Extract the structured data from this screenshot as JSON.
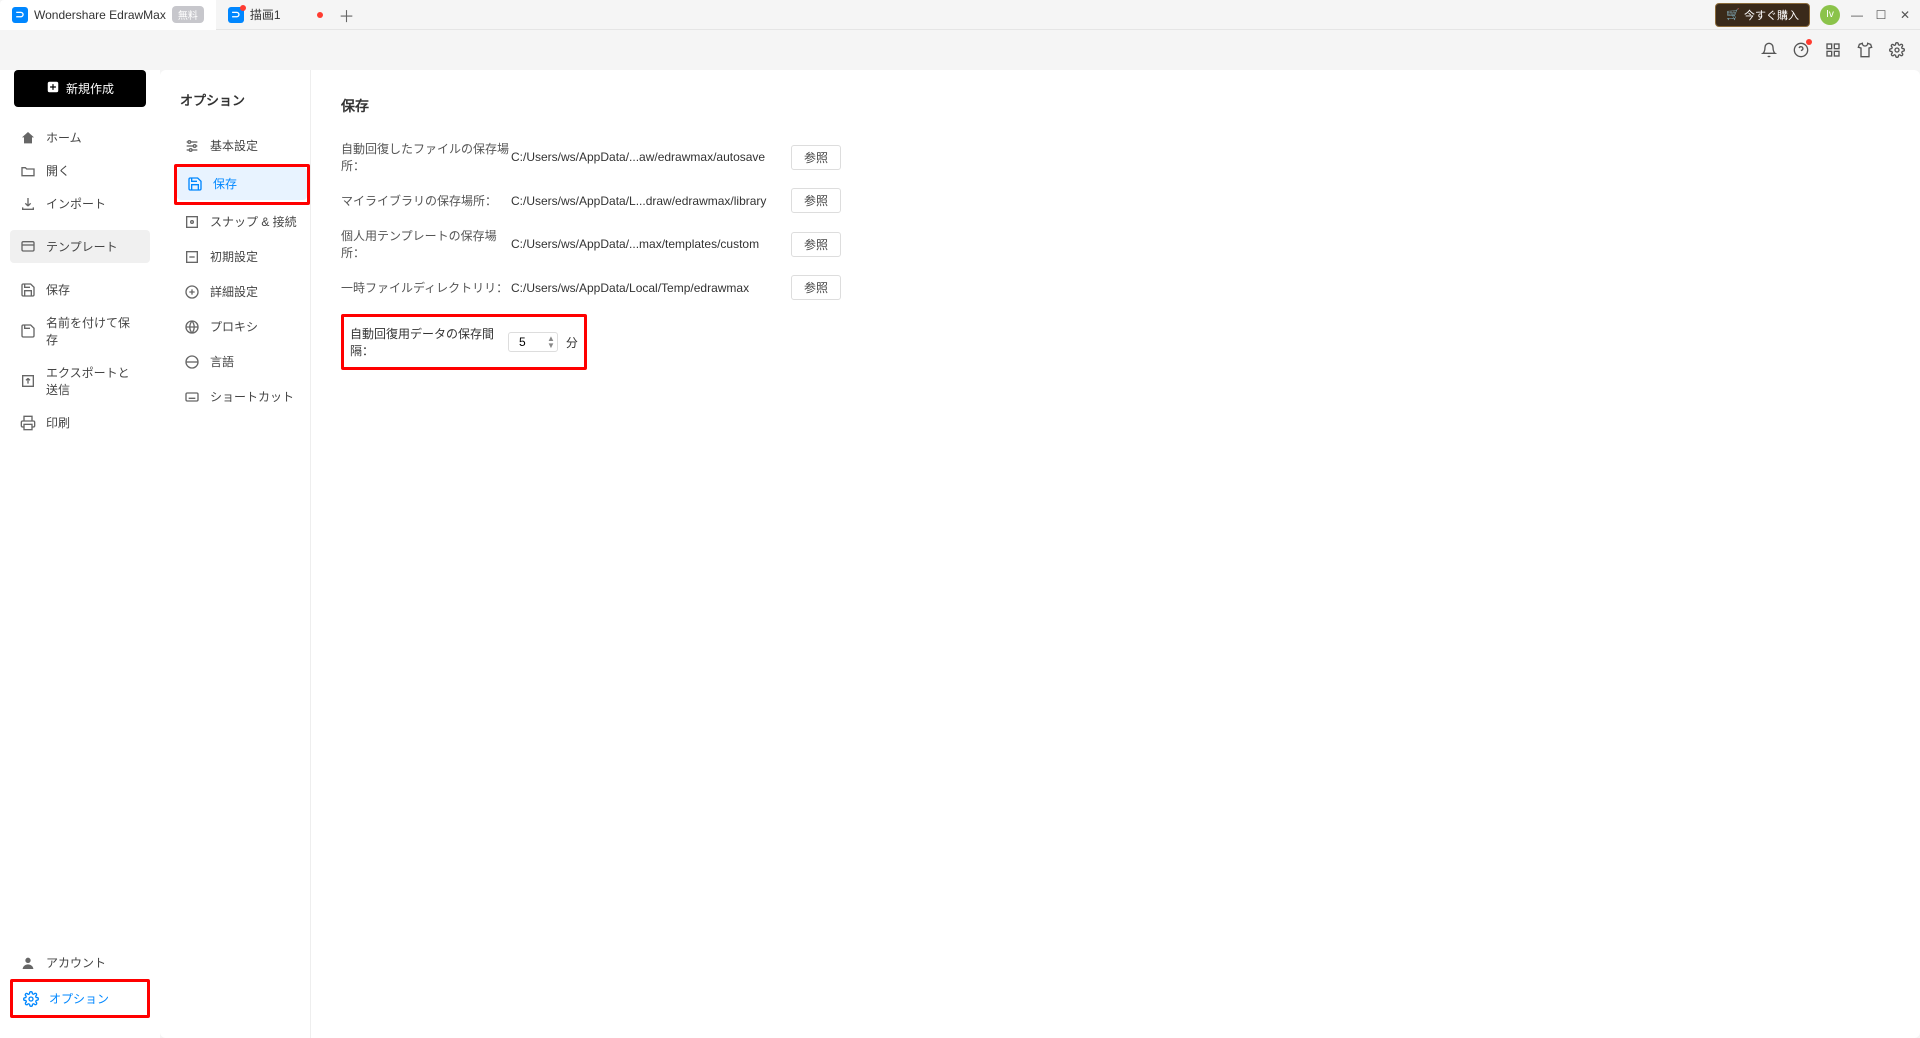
{
  "titlebar": {
    "app_name": "Wondershare EdrawMax",
    "badge_free": "無料",
    "doc_tab": "描画1",
    "buy_label": "今すぐ購入",
    "avatar_initial": "Iv"
  },
  "filemenu": {
    "new_btn": "新規作成",
    "home": "ホーム",
    "open": "開く",
    "import": "インポート",
    "template": "テンプレート",
    "save": "保存",
    "save_as": "名前を付けて保存",
    "export": "エクスポートと送信",
    "print": "印刷",
    "account": "アカウント",
    "options": "オプション"
  },
  "options_nav": {
    "title": "オプション",
    "basic": "基本設定",
    "save": "保存",
    "snap": "スナップ & 接続",
    "initial": "初期設定",
    "advanced": "詳細設定",
    "proxy": "プロキシ",
    "language": "言語",
    "shortcut": "ショートカット"
  },
  "save_panel": {
    "title": "保存",
    "rows": [
      {
        "label": "自動回復したファイルの保存場所：",
        "path": "C:/Users/ws/AppData/...aw/edrawmax/autosave",
        "browse": "参照"
      },
      {
        "label": "マイライブラリの保存場所：",
        "path": "C:/Users/ws/AppData/L...draw/edrawmax/library",
        "browse": "参照"
      },
      {
        "label": "個人用テンプレートの保存場所：",
        "path": "C:/Users/ws/AppData/...max/templates/custom",
        "browse": "参照"
      },
      {
        "label": "一時ファイルディレクトリリ：",
        "path": "C:/Users/ws/AppData/Local/Temp/edrawmax",
        "browse": "参照"
      }
    ],
    "interval_label": "自動回復用データの保存間隔：",
    "interval_value": "5",
    "interval_unit": "分"
  }
}
